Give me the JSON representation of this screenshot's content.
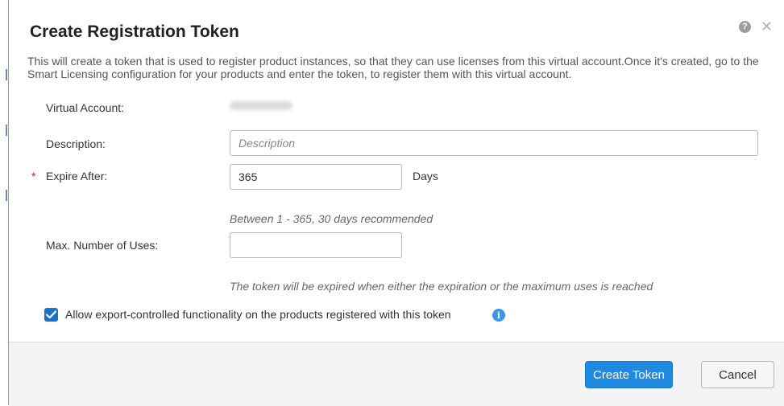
{
  "dialog": {
    "title": "Create Registration Token",
    "intro": "This will create a token that is used to register product instances, so that they can use licenses from this virtual account.Once it's created, go to the Smart Licensing configuration for your products and enter the token, to register them with this virtual account."
  },
  "form": {
    "virtual_account_label": "Virtual Account:",
    "description_label": "Description:",
    "description_placeholder": "Description",
    "description_value": "",
    "required_marker": "*",
    "expire_after_label": "Expire After:",
    "expire_after_value": "365",
    "days_label": "Days",
    "expire_hint": "Between 1 - 365, 30 days recommended",
    "max_uses_label": "Max. Number of Uses:",
    "max_uses_value": "",
    "max_uses_hint": "The token will be expired when either the expiration or the maximum uses is reached",
    "export_checkbox_label": "Allow export-controlled functionality on the products registered with this token",
    "export_checked": true
  },
  "footer": {
    "create_label": "Create Token",
    "cancel_label": "Cancel"
  },
  "icons": {
    "help": "help-icon",
    "close": "close-icon",
    "info": "info-icon",
    "check": "checkmark-icon"
  },
  "colors": {
    "primary": "#1f8ae0",
    "required": "#cc2222",
    "info": "#3f95e0"
  }
}
